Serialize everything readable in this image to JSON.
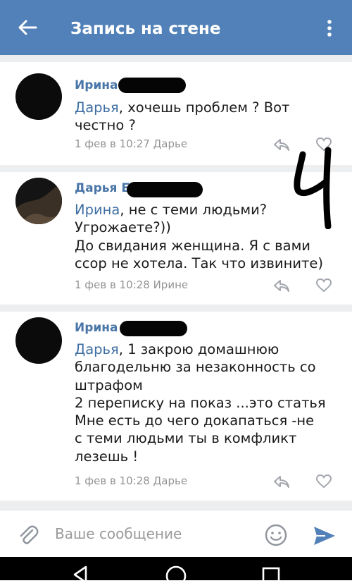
{
  "header": {
    "title": "Запись на стене"
  },
  "comments": [
    {
      "author": "Ирина",
      "mention": "Дарья",
      "text": ", хочешь проблем ? Вот\nчестно ?",
      "meta": "1 фев в 10:27 Дарье"
    },
    {
      "author": "Дарья Б",
      "mention": "Ирина",
      "text": ", не с теми людьми?\nУгрожаете?))\nДо свидания женщина.  Я с вами\nссор не хотела.  Так что извините)",
      "meta": "1 фев в 10:28 Ирине"
    },
    {
      "author": "Ирина",
      "mention": "Дарья",
      "text": ", 1 закрою домашнюю\nблагодельню за незаконность  со\nштрафом\n2 переписку на показ ...это статья\nМне есть до чего докапаться -не\nс теми людьми ты в комфликт\nлезешь !",
      "meta": "1 фев в 10:28 Дарье"
    }
  ],
  "annotation": "Ч",
  "composer": {
    "placeholder": "Ваше сообщение"
  },
  "colors": {
    "header": "#5181b8",
    "author": "#4a76a8",
    "mention": "#3f6ea2",
    "meta": "#939393",
    "send": "#5181b8"
  },
  "icons": [
    "back-arrow-icon",
    "more-vertical-icon",
    "reply-icon",
    "heart-icon",
    "paperclip-icon",
    "emoji-icon",
    "send-icon",
    "nav-back-icon",
    "nav-home-icon",
    "nav-recent-icon"
  ]
}
